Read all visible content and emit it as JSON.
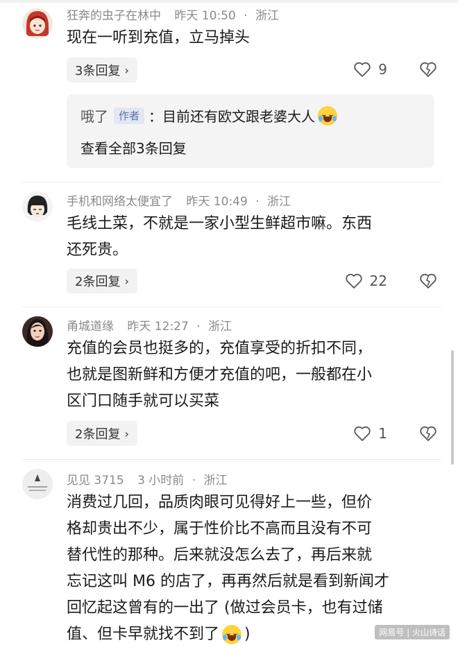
{
  "comments": [
    {
      "user": "狂奔的虫子在林中",
      "time": "昨天 10:50",
      "location": "浙江",
      "text": "现在一听到充值，立马掉头",
      "replies_label": "3条回复",
      "likes": "9",
      "sub_reply": {
        "user": "哦了",
        "author_tag": "作者",
        "text": "：目前还有欧文跟老婆大人",
        "view_all": "查看全部3条回复"
      }
    },
    {
      "user": "手机和网络太便宜了",
      "time": "昨天 10:49",
      "location": "浙江",
      "text_lines": [
        "毛线土菜，不就是一家小型生鲜超市嘛。东西",
        "还死贵。"
      ],
      "replies_label": "2条回复",
      "likes": "22"
    },
    {
      "user": "甬城道缘",
      "time": "昨天 12:27",
      "location": "浙江",
      "text_lines": [
        "充值的会员也挺多的，充值享受的折扣不同，",
        "也就是图新鲜和方便才充值的吧，一般都在小",
        "区门口随手就可以买菜"
      ],
      "replies_label": "2条回复",
      "likes": "1"
    },
    {
      "user": "见见 3715",
      "time": "3 小时前",
      "location": "浙江",
      "text_lines": [
        "消费过几回，品质肉眼可见得好上一些，但价",
        "格却贵出不少，属于性价比不高而且没有不可",
        "替代性的那种。后来就没怎么去了，再后来就",
        "忘记这叫 M6 的店了，再再然后就是看到新闻才",
        "回忆起这曾有的一出了 (做过会员卡，也有过储",
        "值、但卡早就找不到了"
      ],
      "text_end": ")"
    }
  ],
  "separator": "·",
  "chevron": "›",
  "watermark": "网易号 | 火山诗话",
  "colors": {
    "meta": "#8a8a8a",
    "author_tag_bg": "#e1e7f3",
    "author_tag_text": "#5a73a6",
    "sub_box_bg": "#f4f4f5"
  },
  "icons": [
    "heart-icon",
    "broken-heart-icon",
    "chevron-right-icon",
    "crying-emoji-icon"
  ]
}
